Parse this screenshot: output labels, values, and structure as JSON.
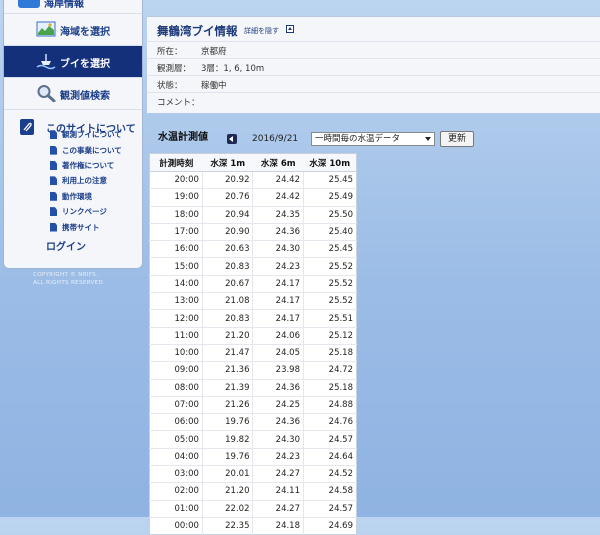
{
  "sidebar": {
    "cut_item_label": "海岸情報",
    "menu": [
      {
        "label": "海域を選択",
        "icon": "map-icon"
      },
      {
        "label": "ブイを選択",
        "icon": "buoy-icon"
      },
      {
        "label": "観測値検索",
        "icon": "magnifier-icon"
      }
    ],
    "about": {
      "label": "このサイトについて",
      "icon": "paperclip-icon"
    },
    "sub_items": [
      "観測ブイについて",
      "この事業について",
      "著作権について",
      "利用上の注意",
      "動作環境",
      "リンクページ",
      "携帯サイト"
    ],
    "login_label": "ログイン",
    "copyright_line1": "COPYRIGHT © NRIFS.",
    "copyright_line2": "ALL RIGHTS RESERVED."
  },
  "info": {
    "title": "舞鶴湾ブイ情報",
    "toggle_label": "詳細を隠す",
    "rows": [
      {
        "key": "所在：",
        "value": "京都府"
      },
      {
        "key": "観測層：",
        "value": "3層：1, 6, 10m"
      },
      {
        "key": "状態：",
        "value": "稼働中"
      },
      {
        "key": "コメント：",
        "value": ""
      }
    ]
  },
  "controls": {
    "section_title": "水温計測値",
    "date": "2016/9/21",
    "select_value": "一時間毎の水温データ",
    "update_label": "更新"
  },
  "table": {
    "headers": [
      "計測時刻",
      "水深 1m",
      "水深 6m",
      "水深 10m"
    ],
    "rows": [
      [
        "20:00",
        "20.92",
        "24.42",
        "25.45"
      ],
      [
        "19:00",
        "20.76",
        "24.42",
        "25.49"
      ],
      [
        "18:00",
        "20.94",
        "24.35",
        "25.50"
      ],
      [
        "17:00",
        "20.90",
        "24.36",
        "25.40"
      ],
      [
        "16:00",
        "20.63",
        "24.30",
        "25.45"
      ],
      [
        "15:00",
        "20.83",
        "24.23",
        "25.52"
      ],
      [
        "14:00",
        "20.67",
        "24.17",
        "25.52"
      ],
      [
        "13:00",
        "21.08",
        "24.17",
        "25.52"
      ],
      [
        "12:00",
        "20.83",
        "24.17",
        "25.51"
      ],
      [
        "11:00",
        "21.20",
        "24.06",
        "25.12"
      ],
      [
        "10:00",
        "21.47",
        "24.05",
        "25.18"
      ],
      [
        "09:00",
        "21.36",
        "23.98",
        "24.72"
      ],
      [
        "08:00",
        "21.39",
        "24.36",
        "25.18"
      ],
      [
        "07:00",
        "21.26",
        "24.25",
        "24.88"
      ],
      [
        "06:00",
        "19.76",
        "24.36",
        "24.76"
      ],
      [
        "05:00",
        "19.82",
        "24.30",
        "24.57"
      ],
      [
        "04:00",
        "19.76",
        "24.23",
        "24.64"
      ],
      [
        "03:00",
        "20.01",
        "24.27",
        "24.52"
      ],
      [
        "02:00",
        "21.20",
        "24.11",
        "24.58"
      ],
      [
        "01:00",
        "22.02",
        "24.27",
        "24.57"
      ],
      [
        "00:00",
        "22.35",
        "24.18",
        "24.69"
      ]
    ]
  }
}
